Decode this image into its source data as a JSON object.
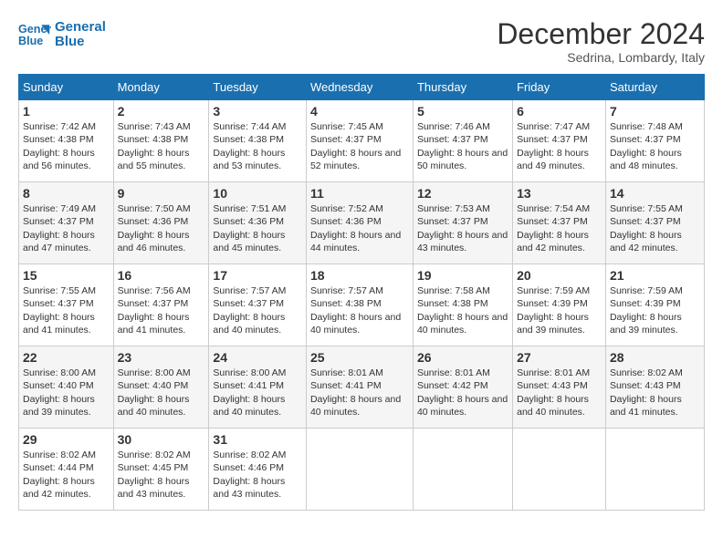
{
  "logo": {
    "line1": "General",
    "line2": "Blue"
  },
  "title": "December 2024",
  "subtitle": "Sedrina, Lombardy, Italy",
  "weekdays": [
    "Sunday",
    "Monday",
    "Tuesday",
    "Wednesday",
    "Thursday",
    "Friday",
    "Saturday"
  ],
  "weeks": [
    [
      {
        "day": "1",
        "sunrise": "7:42 AM",
        "sunset": "4:38 PM",
        "daylight": "8 hours and 56 minutes."
      },
      {
        "day": "2",
        "sunrise": "7:43 AM",
        "sunset": "4:38 PM",
        "daylight": "8 hours and 55 minutes."
      },
      {
        "day": "3",
        "sunrise": "7:44 AM",
        "sunset": "4:38 PM",
        "daylight": "8 hours and 53 minutes."
      },
      {
        "day": "4",
        "sunrise": "7:45 AM",
        "sunset": "4:37 PM",
        "daylight": "8 hours and 52 minutes."
      },
      {
        "day": "5",
        "sunrise": "7:46 AM",
        "sunset": "4:37 PM",
        "daylight": "8 hours and 50 minutes."
      },
      {
        "day": "6",
        "sunrise": "7:47 AM",
        "sunset": "4:37 PM",
        "daylight": "8 hours and 49 minutes."
      },
      {
        "day": "7",
        "sunrise": "7:48 AM",
        "sunset": "4:37 PM",
        "daylight": "8 hours and 48 minutes."
      }
    ],
    [
      {
        "day": "8",
        "sunrise": "7:49 AM",
        "sunset": "4:37 PM",
        "daylight": "8 hours and 47 minutes."
      },
      {
        "day": "9",
        "sunrise": "7:50 AM",
        "sunset": "4:36 PM",
        "daylight": "8 hours and 46 minutes."
      },
      {
        "day": "10",
        "sunrise": "7:51 AM",
        "sunset": "4:36 PM",
        "daylight": "8 hours and 45 minutes."
      },
      {
        "day": "11",
        "sunrise": "7:52 AM",
        "sunset": "4:36 PM",
        "daylight": "8 hours and 44 minutes."
      },
      {
        "day": "12",
        "sunrise": "7:53 AM",
        "sunset": "4:37 PM",
        "daylight": "8 hours and 43 minutes."
      },
      {
        "day": "13",
        "sunrise": "7:54 AM",
        "sunset": "4:37 PM",
        "daylight": "8 hours and 42 minutes."
      },
      {
        "day": "14",
        "sunrise": "7:55 AM",
        "sunset": "4:37 PM",
        "daylight": "8 hours and 42 minutes."
      }
    ],
    [
      {
        "day": "15",
        "sunrise": "7:55 AM",
        "sunset": "4:37 PM",
        "daylight": "8 hours and 41 minutes."
      },
      {
        "day": "16",
        "sunrise": "7:56 AM",
        "sunset": "4:37 PM",
        "daylight": "8 hours and 41 minutes."
      },
      {
        "day": "17",
        "sunrise": "7:57 AM",
        "sunset": "4:37 PM",
        "daylight": "8 hours and 40 minutes."
      },
      {
        "day": "18",
        "sunrise": "7:57 AM",
        "sunset": "4:38 PM",
        "daylight": "8 hours and 40 minutes."
      },
      {
        "day": "19",
        "sunrise": "7:58 AM",
        "sunset": "4:38 PM",
        "daylight": "8 hours and 40 minutes."
      },
      {
        "day": "20",
        "sunrise": "7:59 AM",
        "sunset": "4:39 PM",
        "daylight": "8 hours and 39 minutes."
      },
      {
        "day": "21",
        "sunrise": "7:59 AM",
        "sunset": "4:39 PM",
        "daylight": "8 hours and 39 minutes."
      }
    ],
    [
      {
        "day": "22",
        "sunrise": "8:00 AM",
        "sunset": "4:40 PM",
        "daylight": "8 hours and 39 minutes."
      },
      {
        "day": "23",
        "sunrise": "8:00 AM",
        "sunset": "4:40 PM",
        "daylight": "8 hours and 40 minutes."
      },
      {
        "day": "24",
        "sunrise": "8:00 AM",
        "sunset": "4:41 PM",
        "daylight": "8 hours and 40 minutes."
      },
      {
        "day": "25",
        "sunrise": "8:01 AM",
        "sunset": "4:41 PM",
        "daylight": "8 hours and 40 minutes."
      },
      {
        "day": "26",
        "sunrise": "8:01 AM",
        "sunset": "4:42 PM",
        "daylight": "8 hours and 40 minutes."
      },
      {
        "day": "27",
        "sunrise": "8:01 AM",
        "sunset": "4:43 PM",
        "daylight": "8 hours and 40 minutes."
      },
      {
        "day": "28",
        "sunrise": "8:02 AM",
        "sunset": "4:43 PM",
        "daylight": "8 hours and 41 minutes."
      }
    ],
    [
      {
        "day": "29",
        "sunrise": "8:02 AM",
        "sunset": "4:44 PM",
        "daylight": "8 hours and 42 minutes."
      },
      {
        "day": "30",
        "sunrise": "8:02 AM",
        "sunset": "4:45 PM",
        "daylight": "8 hours and 43 minutes."
      },
      {
        "day": "31",
        "sunrise": "8:02 AM",
        "sunset": "4:46 PM",
        "daylight": "8 hours and 43 minutes."
      },
      null,
      null,
      null,
      null
    ]
  ]
}
